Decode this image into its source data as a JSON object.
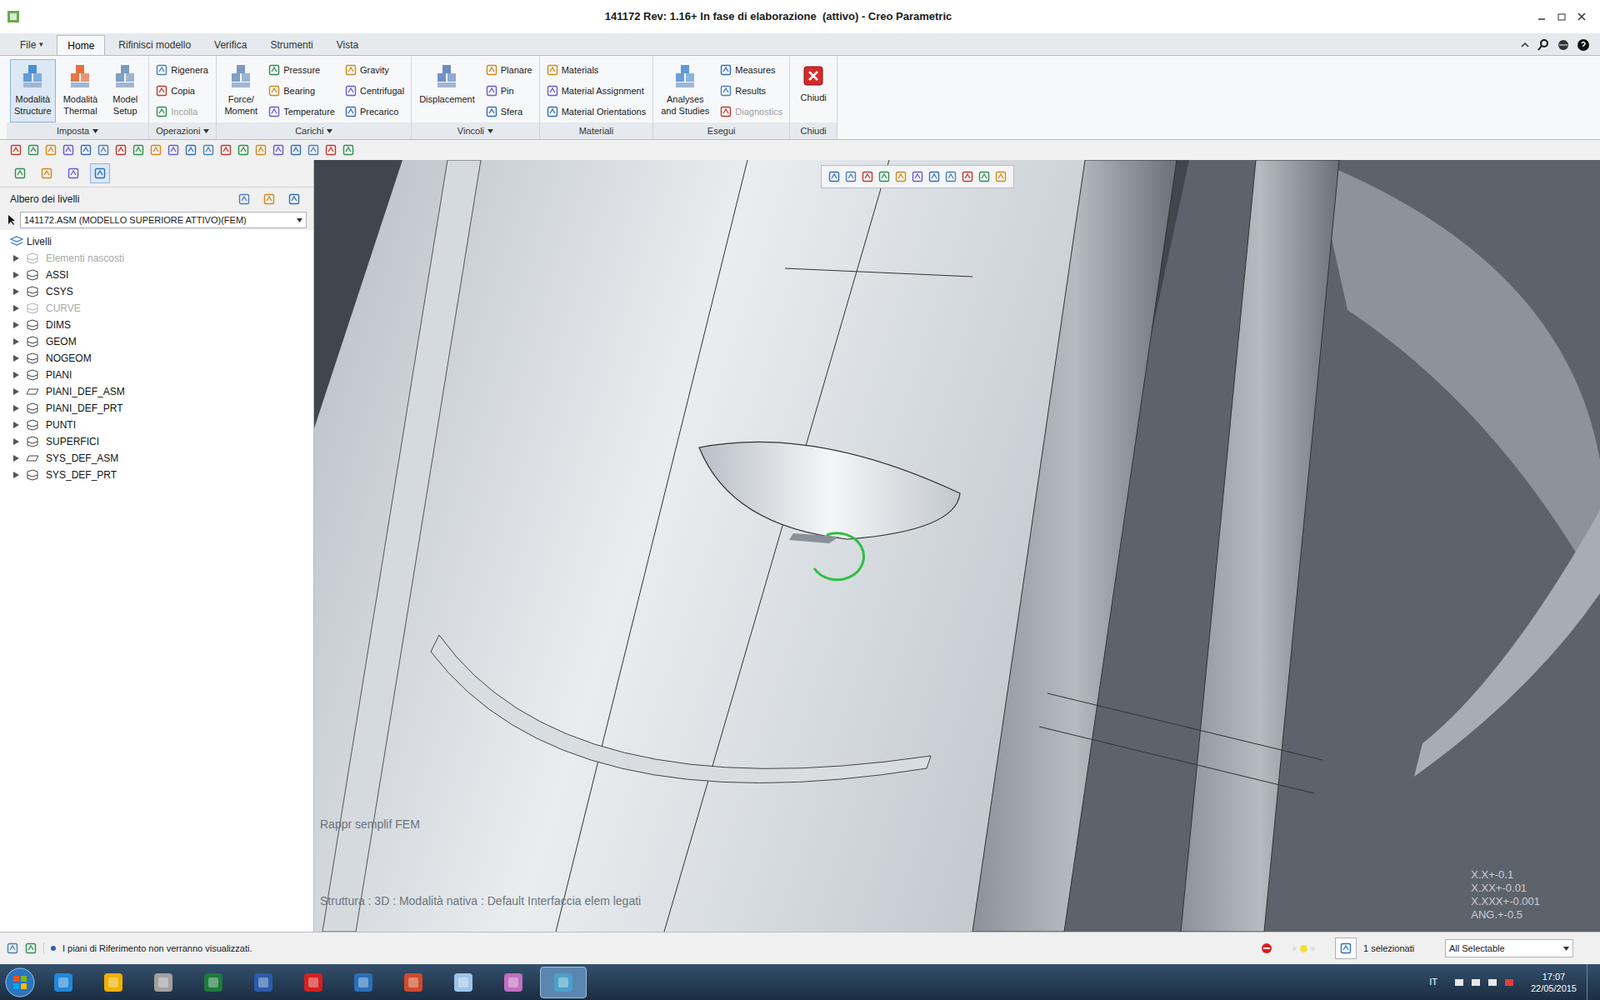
{
  "window": {
    "title": "141172 Rev: 1.16+ In fase di elaborazione  (attivo) - Creo Parametric"
  },
  "tabs": [
    {
      "label": "File",
      "dropdown": "▾",
      "selected": false
    },
    {
      "label": "Home",
      "dropdown": "",
      "selected": true
    },
    {
      "label": "Rifinisci modello",
      "dropdown": "",
      "selected": false
    },
    {
      "label": "Verifica",
      "dropdown": "",
      "selected": false
    },
    {
      "label": "Strumenti",
      "dropdown": "",
      "selected": false
    },
    {
      "label": "Vista",
      "dropdown": "",
      "selected": false
    }
  ],
  "ribbon": [
    {
      "label": "Imposta",
      "dropdown": true,
      "columns": [
        {
          "kind": "big",
          "lines": [
            "Modalità",
            "Structure"
          ],
          "selected": true,
          "disabled": false
        },
        {
          "kind": "big",
          "lines": [
            "Modalità",
            "Thermal"
          ],
          "selected": false,
          "disabled": false
        },
        {
          "kind": "big",
          "lines": [
            "Model",
            "Setup"
          ],
          "selected": false,
          "disabled": false
        }
      ]
    },
    {
      "label": "Operazioni",
      "dropdown": true,
      "columns": [
        {
          "kind": "stack",
          "buttons": [
            {
              "label": "Rigenera",
              "disabled": false
            },
            {
              "label": "Copia",
              "disabled": false
            },
            {
              "label": "Incolla",
              "disabled": true
            }
          ]
        }
      ]
    },
    {
      "label": "Carichi",
      "dropdown": true,
      "columns": [
        {
          "kind": "big",
          "lines": [
            "Force/",
            "Moment"
          ],
          "selected": false,
          "disabled": false
        },
        {
          "kind": "stack",
          "buttons": [
            {
              "label": "Pressure",
              "disabled": false
            },
            {
              "label": "Bearing",
              "disabled": false
            },
            {
              "label": "Temperature",
              "disabled": false
            }
          ]
        },
        {
          "kind": "stack",
          "buttons": [
            {
              "label": "Gravity",
              "disabled": false
            },
            {
              "label": "Centrifugal",
              "disabled": false
            },
            {
              "label": "Precarico",
              "disabled": false
            }
          ]
        }
      ]
    },
    {
      "label": "Vincoli",
      "dropdown": true,
      "columns": [
        {
          "kind": "big",
          "lines": [
            "Displacement"
          ],
          "selected": false,
          "disabled": false
        },
        {
          "kind": "stack",
          "buttons": [
            {
              "label": "Planare",
              "disabled": false
            },
            {
              "label": "Pin",
              "disabled": false
            },
            {
              "label": "Sfera",
              "disabled": false
            }
          ]
        }
      ]
    },
    {
      "label": "Materiali",
      "dropdown": false,
      "columns": [
        {
          "kind": "stack",
          "buttons": [
            {
              "label": "Materials",
              "disabled": false
            },
            {
              "label": "Material Assignment",
              "disabled": false
            },
            {
              "label": "Material Orientations",
              "disabled": false
            }
          ]
        }
      ]
    },
    {
      "label": "Esegui",
      "dropdown": false,
      "columns": [
        {
          "kind": "big",
          "lines": [
            "Analyses",
            "and Studies"
          ],
          "selected": false,
          "disabled": false
        },
        {
          "kind": "stack",
          "buttons": [
            {
              "label": "Measures",
              "disabled": false
            },
            {
              "label": "Results",
              "disabled": false
            },
            {
              "label": "Diagnostics",
              "disabled": true
            }
          ]
        }
      ]
    },
    {
      "label": "Chiudi",
      "dropdown": false,
      "columns": [
        {
          "kind": "big",
          "lines": [
            "Chiudi"
          ],
          "selected": false,
          "disabled": false
        }
      ]
    }
  ],
  "sidebar": {
    "title": "Albero dei livelli",
    "model": "141172.ASM (MODELLO SUPERIORE ATTIVO)(FEM)",
    "root": "Livelli",
    "items": [
      {
        "name": "Elementi nascosti",
        "kind": "layer",
        "disabled": true
      },
      {
        "name": "ASSI",
        "kind": "layer",
        "disabled": false
      },
      {
        "name": "CSYS",
        "kind": "layer",
        "disabled": false
      },
      {
        "name": "CURVE",
        "kind": "layer",
        "disabled": true
      },
      {
        "name": "DIMS",
        "kind": "layer",
        "disabled": false
      },
      {
        "name": "GEOM",
        "kind": "layer",
        "disabled": false
      },
      {
        "name": "NOGEOM",
        "kind": "layer",
        "disabled": false
      },
      {
        "name": "PIANI",
        "kind": "layer",
        "disabled": false
      },
      {
        "name": "PIANI_DEF_ASM",
        "kind": "plane",
        "disabled": false
      },
      {
        "name": "PIANI_DEF_PRT",
        "kind": "layer",
        "disabled": false
      },
      {
        "name": "PUNTI",
        "kind": "layer",
        "disabled": false
      },
      {
        "name": "SUPERFICI",
        "kind": "layer",
        "disabled": false
      },
      {
        "name": "SYS_DEF_ASM",
        "kind": "plane",
        "disabled": false
      },
      {
        "name": "SYS_DEF_PRT",
        "kind": "layer",
        "disabled": false
      }
    ]
  },
  "viewport": {
    "rep": "Rappr semplif FEM",
    "info": "Struttura : 3D : Modalità nativa : Default Interfaccia elem legati",
    "tolerances": [
      "X.X+-0.1",
      "X.XX+-0.01",
      "X.XXX+-0.001",
      "ANG.+-0.5"
    ]
  },
  "status_bar": {
    "message": "I piani di Riferimento non verranno visualizzati.",
    "selection": "1 selezionati",
    "filter": "All Selectable"
  },
  "taskbar": {
    "language": "IT",
    "time": "17:07",
    "date": "22/05/2015"
  }
}
